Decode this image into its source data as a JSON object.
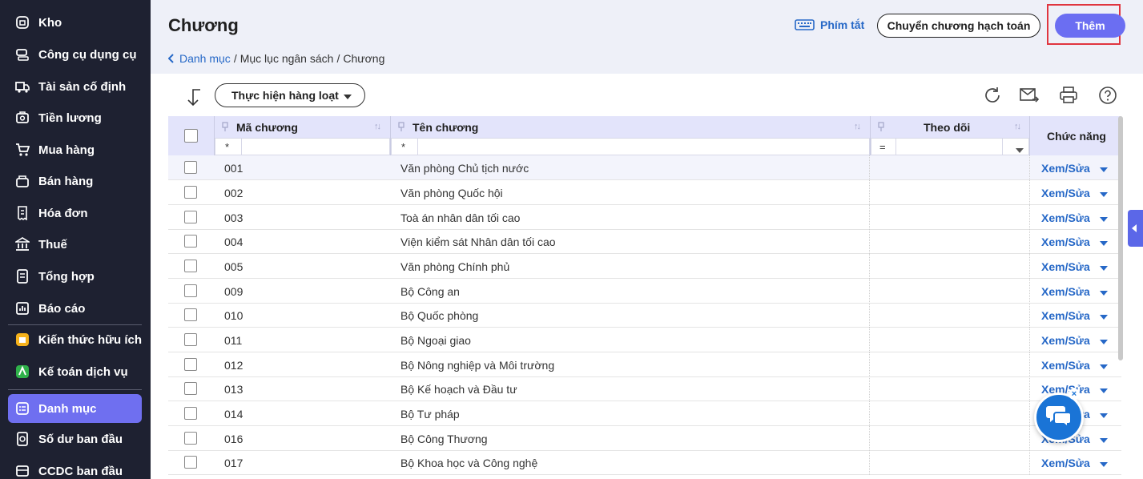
{
  "sidebar": {
    "items": [
      {
        "label": "Kho",
        "icon": "warehouse-icon"
      },
      {
        "label": "Công cụ dụng cụ",
        "icon": "tools-icon"
      },
      {
        "label": "Tài sản cố định",
        "icon": "truck-icon"
      },
      {
        "label": "Tiền lương",
        "icon": "salary-icon"
      },
      {
        "label": "Mua hàng",
        "icon": "cart-icon"
      },
      {
        "label": "Bán hàng",
        "icon": "sales-icon"
      },
      {
        "label": "Hóa đơn",
        "icon": "invoice-icon"
      },
      {
        "label": "Thuế",
        "icon": "tax-icon"
      },
      {
        "label": "Tổng hợp",
        "icon": "summary-icon"
      },
      {
        "label": "Báo cáo",
        "icon": "report-icon"
      },
      {
        "label": "Kiến thức hữu ích",
        "icon": "knowledge-icon"
      },
      {
        "label": "Kế toán dịch vụ",
        "icon": "accounting-service-icon"
      },
      {
        "label": "Danh mục",
        "icon": "catalog-icon",
        "active": true
      },
      {
        "label": "Số dư ban đầu",
        "icon": "opening-balance-icon"
      },
      {
        "label": "CCDC ban đầu",
        "icon": "initial-tools-icon"
      }
    ]
  },
  "header": {
    "title": "Chương",
    "breadcrumb": {
      "link": "Danh mục",
      "middle": "Mục lục ngân sách",
      "current": "Chương",
      "separator": "/"
    },
    "hotkeys_label": "Phím tắt",
    "transfer_button": "Chuyển chương hạch toán",
    "add_button": "Thêm"
  },
  "toolbar": {
    "batch_label": "Thực hiện hàng loạt"
  },
  "table": {
    "columns": {
      "code": "Mã chương",
      "name": "Tên chương",
      "follow": "Theo dõi",
      "action": "Chức năng"
    },
    "filters": {
      "code": "*",
      "name": "*",
      "follow": "="
    },
    "action_label": "Xem/Sửa",
    "rows": [
      {
        "code": "001",
        "name": "Văn phòng Chủ tịch nước"
      },
      {
        "code": "002",
        "name": "Văn phòng Quốc hội"
      },
      {
        "code": "003",
        "name": "Toà án nhân dân tối cao"
      },
      {
        "code": "004",
        "name": "Viện kiểm sát Nhân dân tối cao"
      },
      {
        "code": "005",
        "name": "Văn phòng Chính phủ"
      },
      {
        "code": "009",
        "name": "Bộ Công an"
      },
      {
        "code": "010",
        "name": "Bộ Quốc phòng"
      },
      {
        "code": "011",
        "name": "Bộ Ngoại giao"
      },
      {
        "code": "012",
        "name": "Bộ Nông nghiệp và Môi trường"
      },
      {
        "code": "013",
        "name": "Bộ Kế hoạch và Đầu tư"
      },
      {
        "code": "014",
        "name": "Bộ Tư pháp"
      },
      {
        "code": "016",
        "name": "Bộ Công Thương"
      },
      {
        "code": "017",
        "name": "Bộ Khoa học và Công nghệ"
      }
    ]
  },
  "colors": {
    "sidebar_bg": "#1e2131",
    "accent": "#6b6ef2",
    "link": "#2668c7",
    "highlight_frame": "#e0353f"
  }
}
